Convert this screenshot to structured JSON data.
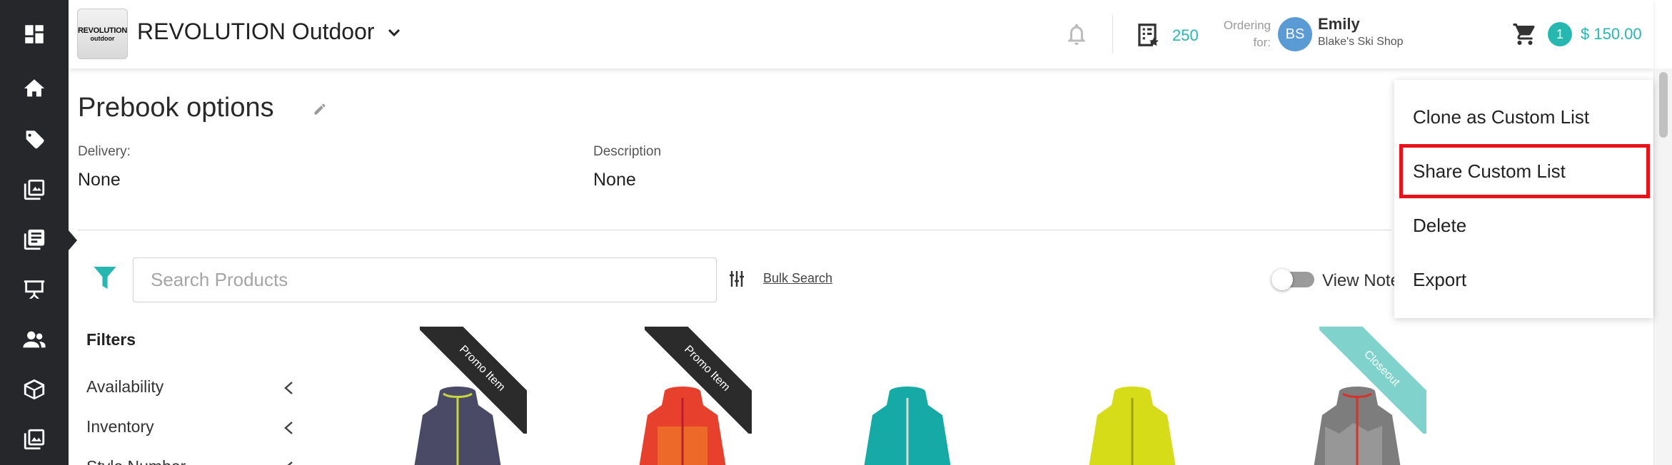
{
  "rail": {
    "items": [
      {
        "icon": "dashboard-icon"
      },
      {
        "icon": "home-icon"
      },
      {
        "icon": "tag-icon"
      },
      {
        "icon": "catalog-icon"
      },
      {
        "icon": "lists-icon"
      },
      {
        "icon": "presentation-icon"
      },
      {
        "icon": "users-icon"
      },
      {
        "icon": "box-icon"
      },
      {
        "icon": "images-icon"
      }
    ]
  },
  "header": {
    "logo_line1": "REVOLUTION",
    "logo_line2": "outdoor",
    "brand": "REVOLUTION Outdoor",
    "points": "250",
    "ordering_for_line1": "Ordering",
    "ordering_for_line2": "for:",
    "avatar_initials": "BS",
    "user_name": "Emily",
    "user_shop": "Blake's Ski Shop",
    "cart_count": "1",
    "cart_total": "$ 150.00"
  },
  "page": {
    "title": "Prebook options",
    "delivery_label": "Delivery:",
    "delivery_value": "None",
    "description_label": "Description",
    "description_value": "None"
  },
  "toolbar": {
    "search_placeholder": "Search Products",
    "search_value": "",
    "bulk_search_label": "Bulk Search",
    "view_notes_label": "View Notes",
    "view_notes_on": false
  },
  "filters": {
    "heading": "Filters",
    "items": [
      "Availability",
      "Inventory",
      "Style Number"
    ]
  },
  "products": [
    {
      "badge": "Promo Item",
      "badge_color": "#2b2b2b",
      "jacket_color": "#4b4a66"
    },
    {
      "badge": "Promo Item",
      "badge_color": "#2b2b2b",
      "jacket_color": "#e7402c"
    },
    {
      "badge": "",
      "badge_color": "",
      "jacket_color": "#16aaa6"
    },
    {
      "badge": "",
      "badge_color": "",
      "jacket_color": "#d6dd18"
    },
    {
      "badge": "Closeout",
      "badge_color": "#7fd3cc",
      "jacket_color": "#7d7d7d"
    }
  ],
  "menu": {
    "items": [
      {
        "label": "Clone as Custom List",
        "highlighted": false
      },
      {
        "label": "Share Custom List",
        "highlighted": true
      },
      {
        "label": "Delete",
        "highlighted": false
      },
      {
        "label": "Export",
        "highlighted": false
      }
    ]
  },
  "colors": {
    "accent": "#27b7b1",
    "rail_bg": "#26272b",
    "highlight": "#e8121a"
  }
}
